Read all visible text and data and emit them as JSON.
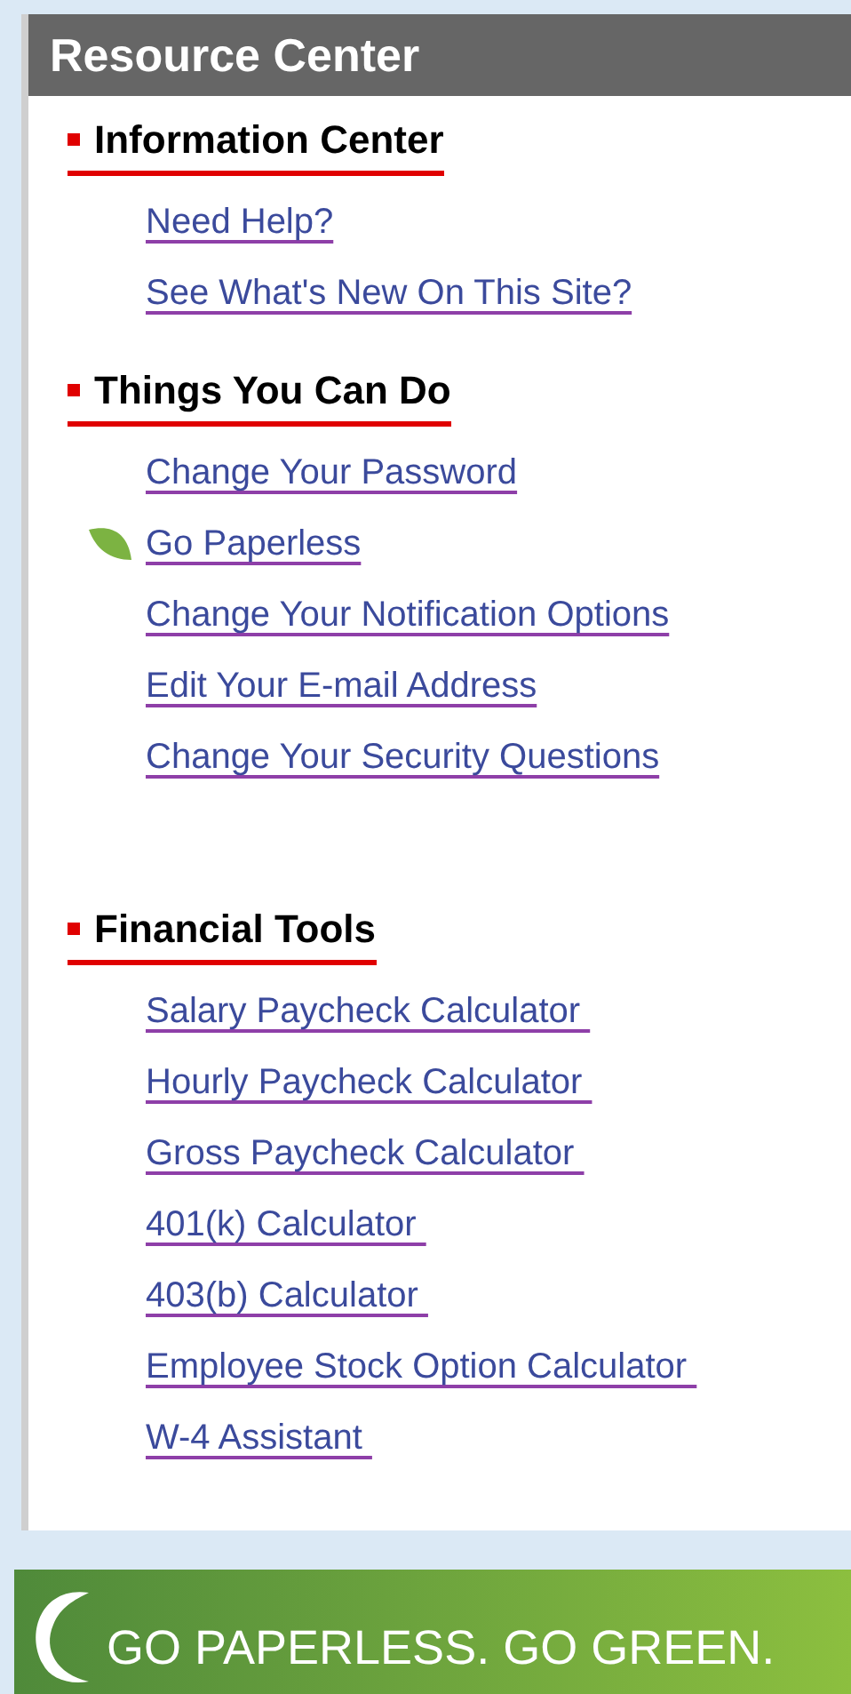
{
  "panel": {
    "title": "Resource Center"
  },
  "sections": [
    {
      "title": "Information Center",
      "links": [
        {
          "label": "Need Help?",
          "kind": "plain"
        },
        {
          "label": "See What's New On This Site?",
          "kind": "plain"
        }
      ]
    },
    {
      "title": "Things You Can Do",
      "links": [
        {
          "label": "Change Your Password",
          "kind": "plain"
        },
        {
          "label": "Go Paperless",
          "kind": "leaf"
        },
        {
          "label": "Change Your Notification Options",
          "kind": "plain"
        },
        {
          "label": "Edit Your E-mail Address",
          "kind": "plain"
        },
        {
          "label": "Change Your Security Questions",
          "kind": "plain"
        }
      ]
    },
    {
      "title": "Financial Tools",
      "links": [
        {
          "label": "Salary Paycheck Calculator ",
          "kind": "plain"
        },
        {
          "label": "Hourly Paycheck Calculator ",
          "kind": "plain"
        },
        {
          "label": "Gross Paycheck Calculator ",
          "kind": "plain"
        },
        {
          "label": "401(k) Calculator ",
          "kind": "plain"
        },
        {
          "label": "403(b) Calculator ",
          "kind": "plain"
        },
        {
          "label": "Employee Stock Option Calculator ",
          "kind": "plain"
        },
        {
          "label": "W-4 Assistant ",
          "kind": "plain"
        }
      ]
    }
  ],
  "banner": {
    "text": "GO PAPERLESS. GO GREEN."
  }
}
